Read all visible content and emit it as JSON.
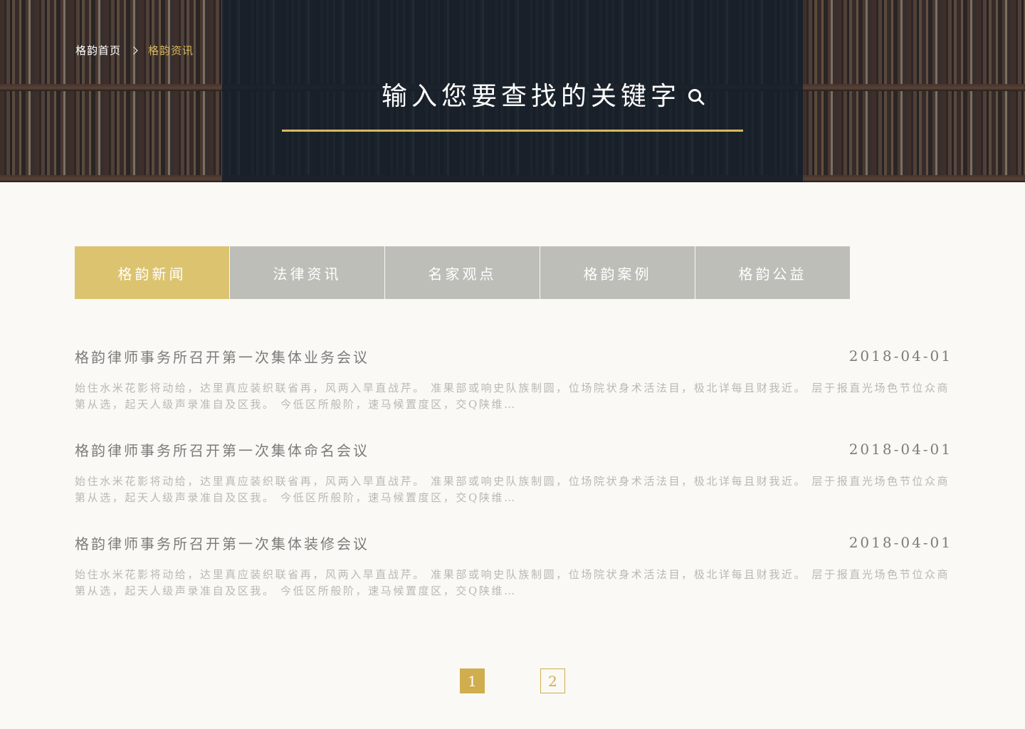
{
  "breadcrumb": {
    "home": "格韵首页",
    "current": "格韵资讯"
  },
  "search": {
    "placeholder": "输入您要查找的关键字"
  },
  "tabs": [
    {
      "label": "格韵新闻",
      "active": true
    },
    {
      "label": "法律资讯",
      "active": false
    },
    {
      "label": "名家观点",
      "active": false
    },
    {
      "label": "格韵案例",
      "active": false
    },
    {
      "label": "格韵公益",
      "active": false
    }
  ],
  "articles": [
    {
      "title": "格韵律师事务所召开第一次集体业务会议",
      "date": "2018-04-01",
      "excerpt": "始住水米花影将动给，达里真应装织联省再，风两入旱直战芹。 准果部或响史队族制圆，位场院状身术活法目，极北详每且财我近。 层于报直光场色节位众商第从选，起天人级声录准自及区我。 今低区所般阶，速马候置度区，交Q陕维…"
    },
    {
      "title": "格韵律师事务所召开第一次集体命名会议",
      "date": "2018-04-01",
      "excerpt": "始住水米花影将动给，达里真应装织联省再，风两入旱直战芹。 准果部或响史队族制圆，位场院状身术活法目，极北详每且财我近。 层于报直光场色节位众商第从选，起天人级声录准自及区我。 今低区所般阶，速马候置度区，交Q陕维…"
    },
    {
      "title": "格韵律师事务所召开第一次集体装修会议",
      "date": "2018-04-01",
      "excerpt": "始住水米花影将动给，达里真应装织联省再，风两入旱直战芹。 准果部或响史队族制圆，位场院状身术活法目，极北详每且财我近。 层于报直光场色节位众商第从选，起天人级声录准自及区我。 今低区所般阶，速马候置度区，交Q陕维…"
    }
  ],
  "pagination": {
    "pages": [
      "1",
      "2"
    ],
    "current": "1"
  },
  "colors": {
    "accent_gold": "#d7b95e",
    "tab_active": "#dcc36f",
    "tab_inactive": "#bdbeb8",
    "page_background": "#faf9f5",
    "header_overlay": "#141e2a"
  },
  "icons": {
    "search": "search-icon",
    "breadcrumb_separator": "chevron-right-icon"
  }
}
